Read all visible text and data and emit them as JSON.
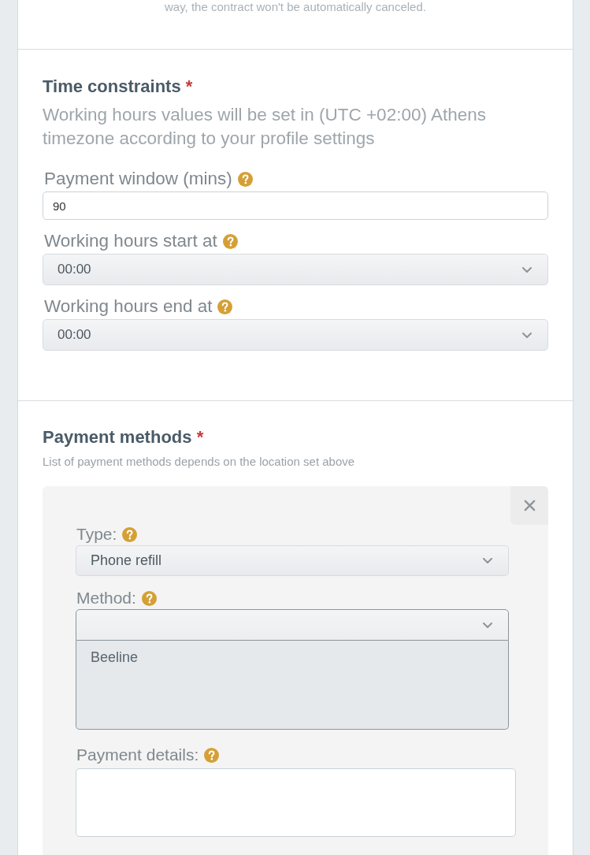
{
  "top_note": "way, the contract won't be automatically canceled.",
  "time_constraints": {
    "title": "Time constraints",
    "required_mark": "*",
    "description": "Working hours values will be set in (UTC +02:00) Athens timezone according to your profile settings",
    "fields": [
      {
        "kind": "input",
        "label": "Payment window (mins)",
        "value": "90"
      },
      {
        "kind": "select",
        "label": "Working hours start at",
        "value": "00:00",
        "expanded": false
      },
      {
        "kind": "select",
        "label": "Working hours end at",
        "value": "00:00",
        "expanded": false
      }
    ]
  },
  "payment_methods": {
    "title": "Payment methods",
    "required_mark": "*",
    "description": "List of payment methods depends on the location set above",
    "entries": [
      {
        "fields": [
          {
            "kind": "select",
            "label": "Type:",
            "value": "Phone refill",
            "expanded": false
          },
          {
            "kind": "select",
            "label": "Method:",
            "expanded": true,
            "options": [
              {
                "label": "Beeline",
                "selected": false
              }
            ]
          },
          {
            "kind": "textarea",
            "label": "Payment details:"
          }
        ]
      }
    ]
  }
}
